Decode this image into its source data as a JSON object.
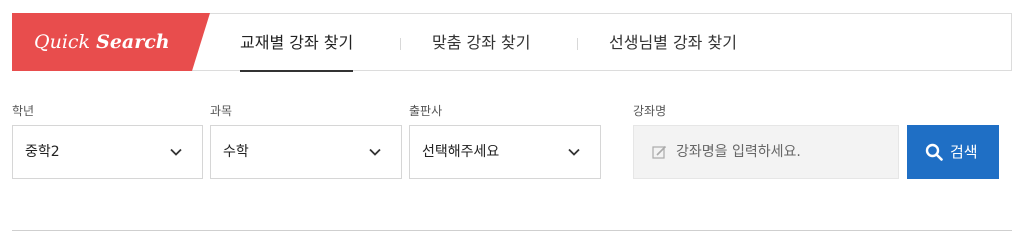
{
  "badge": {
    "light": "Quick",
    "bold": "Search"
  },
  "tabs": [
    {
      "label": "교재별 강좌 찾기",
      "active": true
    },
    {
      "label": "맞춤 강좌 찾기",
      "active": false
    },
    {
      "label": "선생님별 강좌 찾기",
      "active": false
    }
  ],
  "filters": {
    "grade": {
      "label": "학년",
      "value": "중학2"
    },
    "subject": {
      "label": "과목",
      "value": "수학"
    },
    "publisher": {
      "label": "출판사",
      "value": "선택해주세요"
    }
  },
  "course_search": {
    "label": "강좌명",
    "placeholder": "강좌명을 입력하세요.",
    "button_label": "검색"
  },
  "colors": {
    "badge_red": "#e84d4d",
    "button_blue": "#1f6fc5",
    "active_underline": "#333333"
  },
  "icons": {
    "dropdown": "chevron-down-icon",
    "input": "pencil-icon",
    "button": "search-icon"
  }
}
